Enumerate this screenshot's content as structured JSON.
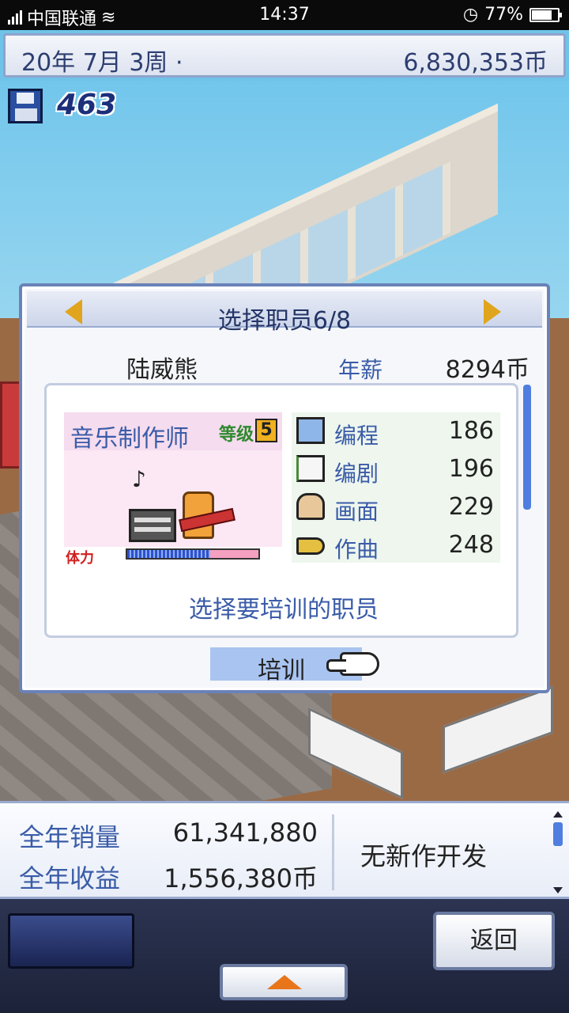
{
  "status_bar": {
    "carrier": "中国联通",
    "time": "14:37",
    "battery": "77%",
    "battery_level": 0.77
  },
  "top_bar": {
    "date": "20年 7月 3周 ·",
    "money": "6,830,353币"
  },
  "save_counter": "463",
  "dialog": {
    "title": "选择职员6/8",
    "staff_name": "陆威熊",
    "salary_label": "年薪",
    "salary_value": "8294币",
    "job": "音乐制作师",
    "level_label": "等级",
    "level_value": "5",
    "stamina_label": "体力",
    "stamina_level": 0.63,
    "note": "♪",
    "stats": [
      {
        "icon": "monitor-icon",
        "label": "编程",
        "value": "186"
      },
      {
        "icon": "book-icon",
        "label": "编剧",
        "value": "196"
      },
      {
        "icon": "paintbrush-icon",
        "label": "画面",
        "value": "229"
      },
      {
        "icon": "trumpet-icon",
        "label": "作曲",
        "value": "248"
      }
    ],
    "hint": "选择要培训的职员",
    "train_button": "培训"
  },
  "bottom_panel": {
    "annual_sales_label": "全年销量",
    "annual_sales_value": "61,341,880",
    "annual_profit_label": "全年收益",
    "annual_profit_value": "1,556,380币",
    "dev_status": "无新作开发"
  },
  "nav": {
    "back_button": "返回"
  }
}
